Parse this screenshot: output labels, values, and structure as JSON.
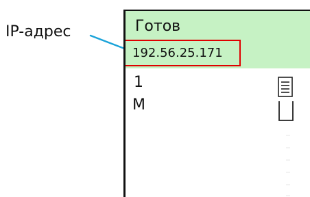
{
  "callout": {
    "label": "IP-адрес",
    "line_color": "#1aa3d9"
  },
  "screen": {
    "status": "Готов",
    "ip_address": "192.56.25.171",
    "line_one": "1",
    "line_two": "M",
    "status_band_color": "#c6f2c4",
    "highlight_color": "#e00000",
    "icons": {
      "list": "list-icon",
      "checkbox": "checkbox-icon"
    }
  }
}
